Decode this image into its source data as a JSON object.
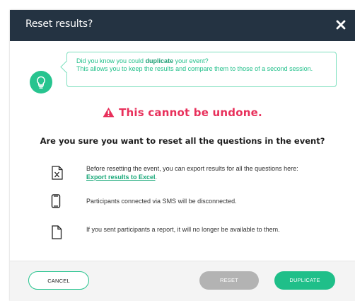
{
  "dialog": {
    "title": "Reset results?"
  },
  "tip": {
    "line1_prefix": "Did you know you could ",
    "line1_bold": "duplicate",
    "line1_suffix": " your event?",
    "line2": "This allows you to keep the results and compare them to those of a second session."
  },
  "warning": {
    "text": "This cannot be undone."
  },
  "question": {
    "text": "Are you sure you want to reset all the questions in the event?"
  },
  "items": [
    {
      "icon": "excel-file-icon",
      "text": "Before resetting the event, you can export results for all the questions here: ",
      "link": "Export results to Excel",
      "suffix": "."
    },
    {
      "icon": "mobile-phone-icon",
      "text": "Participants connected via SMS will be disconnected."
    },
    {
      "icon": "document-icon",
      "text": "If you sent participants a report, it will no longer be available to them."
    }
  ],
  "buttons": {
    "cancel": "CANCEL",
    "reset": "RESET",
    "duplicate": "DUPLICATE"
  },
  "colors": {
    "header": "#243342",
    "accent": "#27c48f",
    "warning": "#e8305b",
    "disabled": "#b3b3b3"
  }
}
